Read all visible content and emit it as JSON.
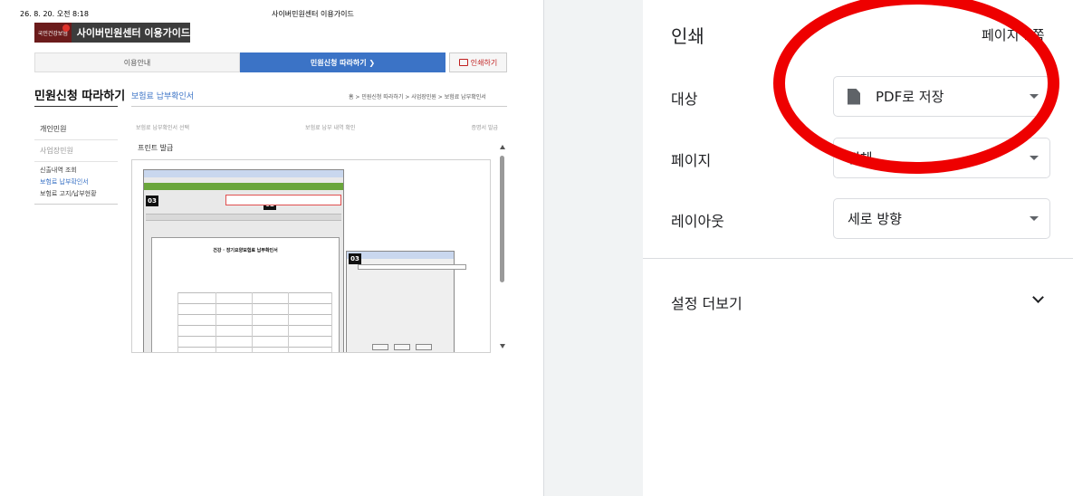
{
  "preview": {
    "header_date": "26. 8. 20. 오전 8:18",
    "header_title": "사이버민원센터 이용가이드",
    "logo_badge": "국민건강보험",
    "logo_text": "사이버민원센터 이용가이드",
    "nav": {
      "tab_guide": "이용안내",
      "tab_follow": "민원신청 따라하기 ❯",
      "print_label": "인쇄하기"
    },
    "section_title": "민원신청 따라하기",
    "section_sub": "보험료 납부확인서",
    "breadcrumb": "홈 > 민원신청 따라하기 > 사업장민원 > 보험료 납부확인서",
    "side_items": [
      "개인민원",
      "사업장민원"
    ],
    "side_sub": [
      "신출내역 조회",
      "보험료 납부확인서",
      "보험료 고지/납부현황"
    ],
    "steps": [
      "보험료 납부확인서 선택",
      "보험료 납부 내역 확인",
      "증명서 발급"
    ],
    "print_issue": "프린트 발급",
    "inner": {
      "badge_03": "03",
      "badge_02": "02",
      "badge_01": "01",
      "badge_03b": "03",
      "doc_title": "건강 · 장기요양보험료 납부확인서"
    }
  },
  "panel": {
    "title": "인쇄",
    "pages": "페이지 1쪽",
    "destination_label": "대상",
    "destination_value": "PDF로 저장",
    "pages_label": "페이지",
    "pages_value": "전체",
    "layout_label": "레이아웃",
    "layout_value": "세로 방향",
    "more_settings": "설정 더보기"
  },
  "annotation": {
    "color": "#ee0000",
    "shape": "ellipse"
  }
}
